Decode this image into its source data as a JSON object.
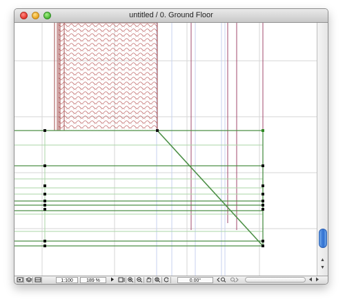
{
  "window": {
    "title": "untitled / 0. Ground Floor"
  },
  "colors": {
    "grid": "#d5d5d5",
    "wall": "#4c8f46",
    "hatch": "#c06a6a",
    "node": "#111111",
    "accent": "#2f6fd1"
  },
  "statusbar": {
    "scale": "1:100",
    "zoom": "189 %",
    "angle": "0.00°",
    "icons": [
      "navigator-icon",
      "layers-icon",
      "views-icon",
      "play-icon",
      "zoom-fit-icon",
      "zoom-in-icon",
      "zoom-out-icon",
      "pan-icon",
      "fit-in-window-icon",
      "rotate-icon",
      "zoom-previous-icon",
      "zoom-next-icon",
      "scroll-left-icon",
      "scroll-right-icon"
    ]
  },
  "scrollbar": {
    "up_arrow": "▲",
    "down_arrow": "▼"
  }
}
